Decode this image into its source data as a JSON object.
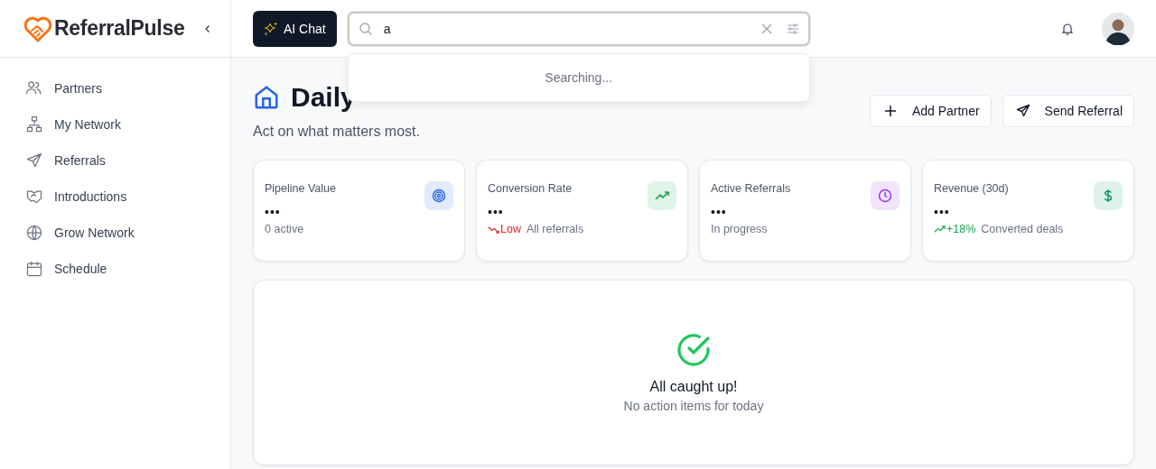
{
  "brand": {
    "name": "ReferralPulse"
  },
  "sidebar": {
    "items": [
      {
        "label": "Partners",
        "selected": false
      },
      {
        "label": "My Network",
        "selected": false
      },
      {
        "label": "Referrals",
        "selected": false
      },
      {
        "label": "Introductions",
        "selected": false
      },
      {
        "label": "Grow Network",
        "selected": false
      },
      {
        "label": "Schedule",
        "selected": false
      }
    ]
  },
  "header": {
    "ai_button": "AI Chat",
    "search": {
      "value": "a",
      "status": "Searching..."
    }
  },
  "page": {
    "title": "Daily",
    "subtitle": "Act on what matters most.",
    "actions": [
      {
        "label": "Add Partner"
      },
      {
        "label": "Send Referral"
      }
    ]
  },
  "stats": [
    {
      "title": "Pipeline Value",
      "value": "•••",
      "color": "#2563eb",
      "note": "0 active"
    },
    {
      "title": "Conversion Rate",
      "value": "•••",
      "color": "#16a34a",
      "trend": {
        "kind": "down",
        "text": "Low"
      },
      "note": "All referrals"
    },
    {
      "title": "Active Referrals",
      "value": "•••",
      "color": "#9333ea",
      "note": "In progress"
    },
    {
      "title": "Revenue (30d)",
      "value": "•••",
      "color": "#059669",
      "trend": {
        "kind": "up",
        "text": "+18%"
      },
      "note": "Converted deals"
    }
  ],
  "actions_panel": {
    "title": "All caught up!",
    "message": "No action items for today"
  }
}
